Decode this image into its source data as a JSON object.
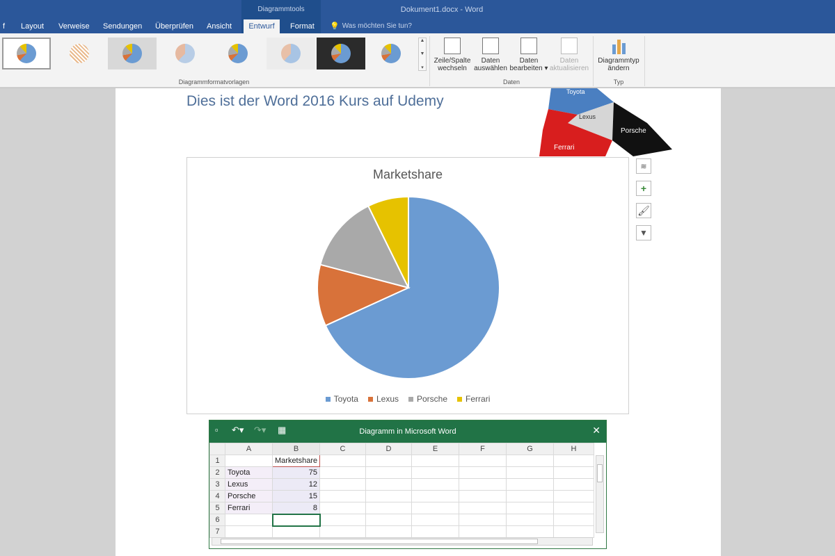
{
  "window": {
    "context_group": "Diagrammtools",
    "doc_title": "Dokument1.docx - Word",
    "tell_me": "Was möchten Sie tun?"
  },
  "tabs": [
    {
      "label": "f"
    },
    {
      "label": "Layout"
    },
    {
      "label": "Verweise"
    },
    {
      "label": "Sendungen"
    },
    {
      "label": "Überprüfen"
    },
    {
      "label": "Ansicht"
    },
    {
      "label": "Entwurf"
    },
    {
      "label": "Format"
    }
  ],
  "ribbon": {
    "styles_group_label": "Diagrammformatvorlagen",
    "data_group_label": "Daten",
    "type_group_label": "Typ",
    "switch_row_col": [
      "Zeile/Spalte",
      "wechseln"
    ],
    "select_data": [
      "Daten",
      "auswählen"
    ],
    "edit_data": [
      "Daten",
      "bearbeiten ▾"
    ],
    "refresh_data": [
      "Daten",
      "aktualisieren"
    ],
    "change_type": [
      "Diagrammtyp",
      "ändern"
    ]
  },
  "document": {
    "heading": "Dies ist der Word 2016 Kurs auf Udemy"
  },
  "pie3d_labels": [
    "Toyota",
    "Lexus",
    "Porsche",
    "Ferrari"
  ],
  "colors": {
    "toyota": "#6b9bd2",
    "lexus": "#d8723a",
    "porsche": "#a9a9a9",
    "ferrari": "#e6c200",
    "pie3d_toyota": "#4a7fc1",
    "pie3d_lexus": "#c9c9c9",
    "pie3d_porsche": "#111111",
    "pie3d_ferrari": "#d81e1e"
  },
  "chart_data": {
    "type": "pie",
    "title": "Marketshare",
    "categories": [
      "Toyota",
      "Lexus",
      "Porsche",
      "Ferrari"
    ],
    "values": [
      75,
      12,
      15,
      8
    ],
    "legend": "bottom"
  },
  "excel": {
    "title": "Diagramm in Microsoft Word",
    "columns": [
      "A",
      "B",
      "C",
      "D",
      "E",
      "F",
      "G",
      "H"
    ],
    "rows": [
      {
        "n": "1",
        "a": "",
        "b": "Marketshare"
      },
      {
        "n": "2",
        "a": "Toyota",
        "b": "75"
      },
      {
        "n": "3",
        "a": "Lexus",
        "b": "12"
      },
      {
        "n": "4",
        "a": "Porsche",
        "b": "15"
      },
      {
        "n": "5",
        "a": "Ferrari",
        "b": "8"
      },
      {
        "n": "6",
        "a": "",
        "b": ""
      },
      {
        "n": "7",
        "a": "",
        "b": ""
      }
    ]
  }
}
